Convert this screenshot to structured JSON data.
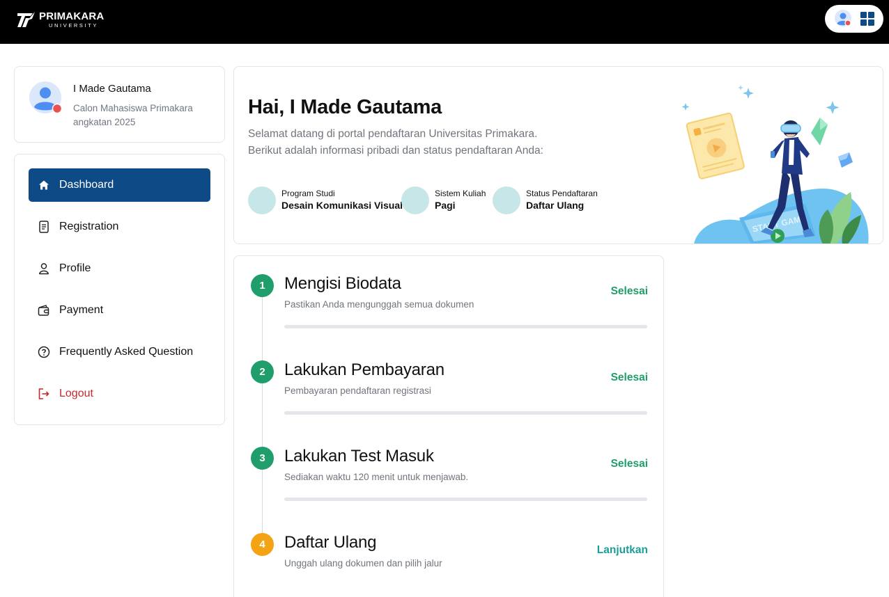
{
  "brand": {
    "name": "PRIMAKARA",
    "subtitle": "UNIVERSITY"
  },
  "profile": {
    "name": "I Made Gautama",
    "role": "Calon Mahasiswa Primakara angkatan 2025"
  },
  "sidebar": {
    "items": [
      {
        "label": "Dashboard",
        "icon": "home-icon",
        "active": true
      },
      {
        "label": "Registration",
        "icon": "document-icon"
      },
      {
        "label": "Profile",
        "icon": "user-icon"
      },
      {
        "label": "Payment",
        "icon": "wallet-icon"
      },
      {
        "label": "Frequently Asked Question",
        "icon": "question-icon"
      },
      {
        "label": "Logout",
        "icon": "logout-icon"
      }
    ]
  },
  "welcome": {
    "title": "Hai, I Made Gautama",
    "line1": "Selamat datang di portal pendaftaran Universitas Primakara.",
    "line2": "Berikut adalah informasi pribadi dan status pendaftaran Anda:",
    "info": [
      {
        "label": "Program Studi",
        "value": "Desain Komunikasi Visual"
      },
      {
        "label": "Sistem Kuliah",
        "value": "Pagi"
      },
      {
        "label": "Status Pendaftaran",
        "value": "Daftar Ulang"
      }
    ],
    "illustration_text": "START GAME"
  },
  "steps": [
    {
      "number": "1",
      "title": "Mengisi Biodata",
      "desc": "Pastikan Anda mengunggah semua dokumen",
      "status": "Selesai"
    },
    {
      "number": "2",
      "title": "Lakukan Pembayaran",
      "desc": "Pembayaran pendaftaran registrasi",
      "status": "Selesai"
    },
    {
      "number": "3",
      "title": "Lakukan Test Masuk",
      "desc": "Sediakan waktu 120 menit untuk menjawab.",
      "status": "Selesai"
    },
    {
      "number": "4",
      "title": "Daftar Ulang",
      "desc": "Unggah ulang dokumen dan pilih jalur",
      "status": "Lanjutkan"
    }
  ],
  "colors": {
    "primary": "#0d4a86",
    "done": "#1f9d6b",
    "pending": "#f3a313",
    "continue": "#1a9e9a",
    "logout": "#c8282d"
  }
}
